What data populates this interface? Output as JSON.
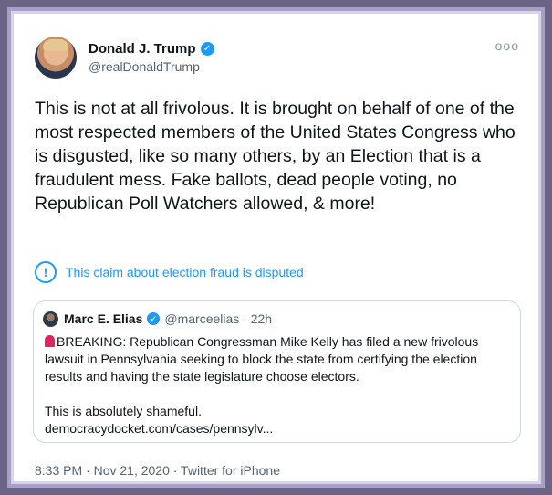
{
  "author": {
    "display_name": "Donald J. Trump",
    "handle": "@realDonaldTrump"
  },
  "tweet": {
    "text": "This is not at all frivolous. It is brought on behalf of one of the most respected members of the United States Congress who is disgusted, like so many others, by an Election that is a fraudulent mess. Fake ballots, dead people voting, no Republican Poll Watchers allowed, & more!",
    "more_menu": "ooo"
  },
  "notice": {
    "icon": "!",
    "text": "This claim about election fraud is disputed"
  },
  "quote": {
    "display_name": "Marc E. Elias",
    "handle_time": "@marceelias · 22h",
    "text1": "BREAKING: Republican Congressman Mike Kelly has filed a new frivolous lawsuit in Pennsylvania seeking to block the state from certifying the election results and having the state legislature choose electors.",
    "text2": "This is absolutely shameful.",
    "link": "democracydocket.com/cases/pennsylv..."
  },
  "meta": {
    "timestamp": "8:33 PM · Nov 21, 2020 · Twitter for iPhone"
  },
  "colors": {
    "frame_bg": "#6b6487",
    "accent": "#1d9bf0",
    "text_primary": "#0f1419",
    "text_secondary": "#536471"
  }
}
